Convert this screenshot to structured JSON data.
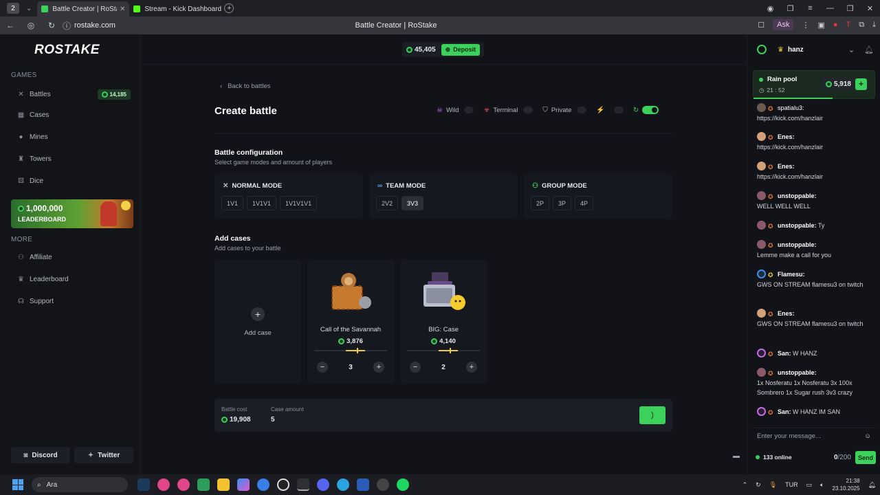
{
  "browser": {
    "workspace_num": "2",
    "tabs": [
      {
        "label": "Battle Creator | RoStake"
      },
      {
        "label": "Stream - Kick Dashboard"
      }
    ],
    "url": "rostake.com",
    "page_title": "Battle Creator | RoStake",
    "ask_label": "Ask"
  },
  "sidebar": {
    "logo": "ROSTAKE",
    "games_header": "GAMES",
    "games": [
      {
        "label": "Battles",
        "badge": "14,185"
      },
      {
        "label": "Cases"
      },
      {
        "label": "Mines"
      },
      {
        "label": "Towers"
      },
      {
        "label": "Dice"
      }
    ],
    "promo_amount": "1,000,000",
    "promo_label": "LEADERBOARD",
    "more_header": "MORE",
    "more": [
      {
        "label": "Affiliate"
      },
      {
        "label": "Leaderboard"
      },
      {
        "label": "Support"
      }
    ],
    "discord": "Discord",
    "twitter": "Twitter"
  },
  "topbar": {
    "balance": "45,405",
    "deposit": "Deposit"
  },
  "page": {
    "back": "Back to battles",
    "title": "Create battle",
    "toggles": [
      {
        "label": "Wild"
      },
      {
        "label": "Terminal"
      },
      {
        "label": "Private"
      }
    ],
    "config_title": "Battle configuration",
    "config_sub": "Select game modes and amount of players",
    "modes": [
      {
        "title": "NORMAL MODE",
        "options": [
          "1V1",
          "1V1V1",
          "1V1V1V1"
        ]
      },
      {
        "title": "TEAM MODE",
        "options": [
          "2V2",
          "3V3"
        ]
      },
      {
        "title": "GROUP MODE",
        "options": [
          "2P",
          "3P",
          "4P"
        ]
      }
    ],
    "selected_mode": "3V3",
    "cases_title": "Add cases",
    "cases_sub": "Add cases to your battle",
    "add_case": "Add case",
    "cases": [
      {
        "name": "Call of the Savannah",
        "price": "3,876",
        "qty": "3"
      },
      {
        "name": "BIG: Case",
        "price": "4,140",
        "qty": "2"
      }
    ],
    "battle_cost_label": "Battle cost",
    "battle_cost": "19,908",
    "case_amount_label": "Case amount",
    "case_amount": "5"
  },
  "chat": {
    "user": "hanz",
    "rain_title": "Rain pool",
    "rain_timer": "21 : 52",
    "rain_amount": "5,918",
    "messages": [
      {
        "user": "spatialu3:",
        "text": "https://kick.com/hanzlair"
      },
      {
        "user": "Enes:",
        "text": "https://kick.com/hanzlair"
      },
      {
        "user": "Enes:",
        "text": "https://kick.com/hanzlair"
      },
      {
        "user": "unstoppable:",
        "text": "WELL WELL WELL"
      },
      {
        "user": "unstoppable:",
        "text": "Ty"
      },
      {
        "user": "unstoppable:",
        "text": "Lemme make a call for you"
      },
      {
        "user": "Flamesu:",
        "text": "GWS ON STREAM flamesu3 on twitch"
      },
      {
        "user": "Enes:",
        "text": "GWS ON STREAM flamesu3 on twitch"
      },
      {
        "user": "San:",
        "text": "W HANZ"
      },
      {
        "user": "unstoppable:",
        "text": "1x Nosferatu 1x Nosferatu 3x 100x Sombrero 1x Sugar rush 3v3 crazy"
      },
      {
        "user": "San:",
        "text": "W HANZ IM SAN"
      }
    ],
    "input_placeholder": "Enter your message...",
    "online": "133 online",
    "count": "0",
    "count_max": "/200",
    "send": "Send"
  },
  "taskbar": {
    "search": "Ara",
    "lang": "TUR",
    "time": "21:38",
    "date": "23.10.2025"
  }
}
